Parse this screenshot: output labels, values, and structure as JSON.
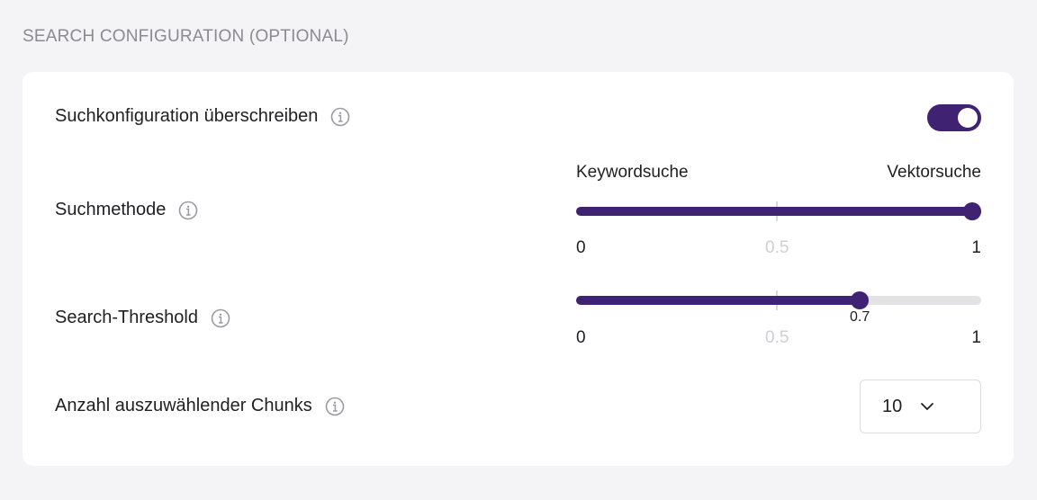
{
  "section": {
    "title": "SEARCH CONFIGURATION (OPTIONAL)"
  },
  "override": {
    "label": "Suchkonfiguration überschreiben",
    "enabled": true
  },
  "search_method": {
    "label": "Suchmethode",
    "left_label": "Keywordsuche",
    "right_label": "Vektorsuche",
    "value": 1,
    "min_label": "0",
    "mid_label": "0.5",
    "max_label": "1"
  },
  "threshold": {
    "label": "Search-Threshold",
    "value": 0.7,
    "value_label": "0.7",
    "min_label": "0",
    "mid_label": "0.5",
    "max_label": "1"
  },
  "chunks": {
    "label": "Anzahl auszuwählender Chunks",
    "selected": "10"
  },
  "colors": {
    "accent": "#3f2372",
    "track": "#e3e3e6"
  }
}
